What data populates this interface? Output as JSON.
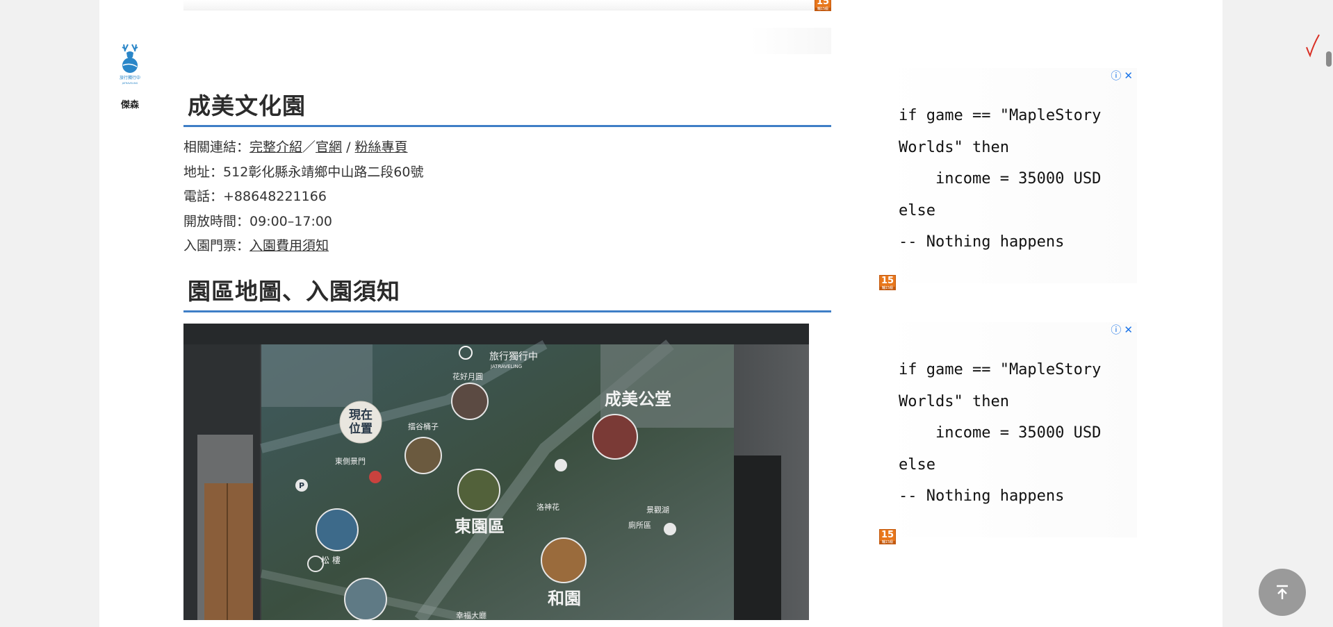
{
  "author": {
    "logo_text": "旅行獨行中",
    "logo_sub": "JATRAVELING",
    "name": "傑森"
  },
  "section1": {
    "title": "成美文化園",
    "links_label": "相關連結：",
    "link_full": "完整介紹",
    "sep1": "／",
    "link_official": "官網",
    "sep2": " / ",
    "link_fans": "粉絲專頁",
    "address_label": "地址：",
    "address": "512彰化縣永靖鄉中山路二段60號",
    "phone_label": "電話：",
    "phone": "+88648221166",
    "hours_label": "開放時間：",
    "hours": "09:00–17:00",
    "ticket_label": "入園門票：",
    "ticket_link": "入園費用須知"
  },
  "section2": {
    "title": "園區地圖、入園須知"
  },
  "map_photo": {
    "labels": {
      "brand": "旅行獨行中",
      "brand_sub": "JATRAVELING",
      "current": "現在",
      "current2": "位置",
      "hall": "成美公堂",
      "east": "東園區",
      "harmony": "和園",
      "flower": "花好月圓",
      "pond": "擂谷桶子",
      "gate": "東側景門",
      "rose": "洛神花",
      "pine": "松 樓",
      "happy": "幸福大廳",
      "lake": "景觀湖",
      "toilet": "廁所區"
    }
  },
  "ads": [
    {
      "code": "if game == \"MapleStory\nWorlds\" then\n    income = 35000 USD\nelse\n-- Nothing happens",
      "info_icon": "ⓘ",
      "close_icon": "✕",
      "rating": "15",
      "rating_sub": "輔15級"
    },
    {
      "code": "if game == \"MapleStory\nWorlds\" then\n    income = 35000 USD\nelse\n-- Nothing happens",
      "info_icon": "ⓘ",
      "close_icon": "✕",
      "rating": "15",
      "rating_sub": "輔15級"
    }
  ],
  "top_rating": {
    "rating": "15",
    "rating_sub": "輔15級"
  }
}
